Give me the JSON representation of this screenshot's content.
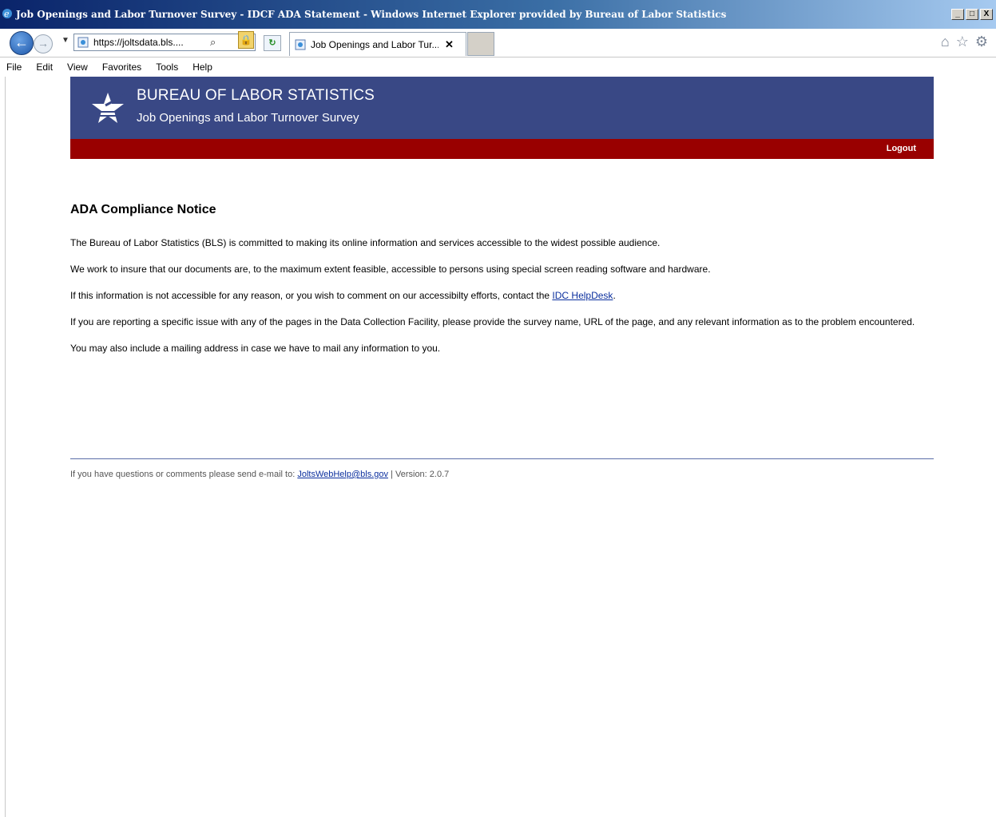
{
  "browser": {
    "window_title": "Job Openings and Labor Turnover Survey - IDCF ADA Statement - Windows Internet Explorer provided by Bureau of Labor Statistics",
    "window_controls": [
      "_",
      "□",
      "X"
    ],
    "address_url": "https://joltsdata.bls....",
    "tab_label": "Job Openings and Labor Tur...",
    "tab_close": "✕",
    "menu": [
      "File",
      "Edit",
      "View",
      "Favorites",
      "Tools",
      "Help"
    ]
  },
  "banner": {
    "agency": "BUREAU OF LABOR STATISTICS",
    "survey": "Job Openings and Labor Turnover Survey",
    "logout": "Logout"
  },
  "content": {
    "heading": "ADA Compliance Notice",
    "p1": "The Bureau of Labor Statistics (BLS) is committed to making its online information and services accessible to the widest possible audience.",
    "p2": "We work to insure that our documents are, to the maximum extent feasible, accessible to persons using special screen reading software and hardware.",
    "p3_before": "If this information is not accessible for any reason, or you wish to comment on our accessibilty efforts, contact the ",
    "p3_link": "IDC HelpDesk",
    "p3_after": ".",
    "p4": "If you are reporting a specific issue with any of the pages in the Data Collection Facility, please provide the survey name, URL of the page, and any relevant information as to the problem encountered.",
    "p5": "You may also include a mailing address in case we have to mail any information to you."
  },
  "footer": {
    "prefix": "If you have questions or comments please send e-mail to: ",
    "email": "JoltsWebHelp@bls.gov",
    "version": " | Version: 2.0.7"
  },
  "colors": {
    "banner_blue": "#394885",
    "banner_red": "#990000",
    "link": "#0b2f9e"
  }
}
